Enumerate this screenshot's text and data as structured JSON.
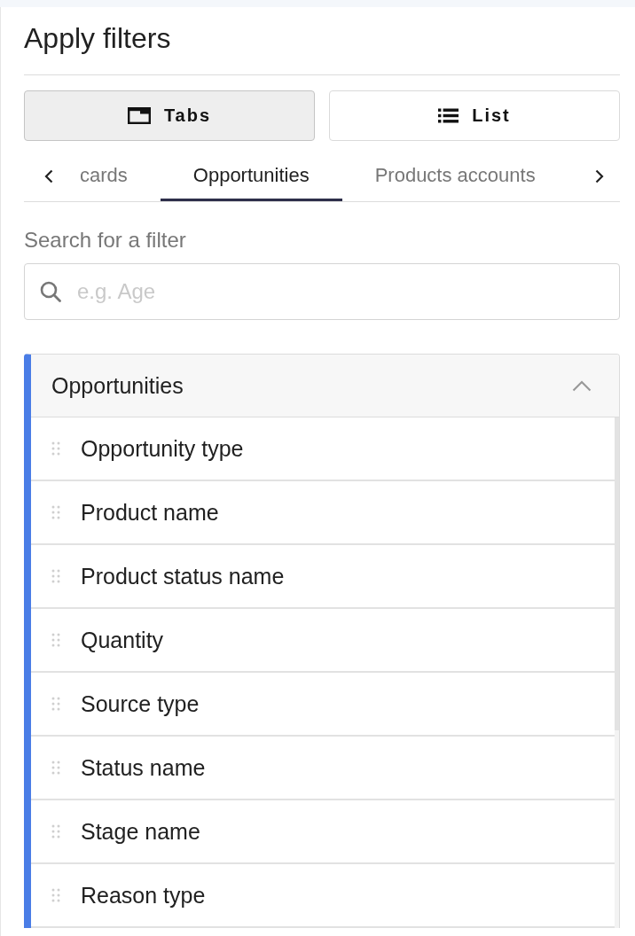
{
  "panel": {
    "title": "Apply filters"
  },
  "view_toggle": [
    {
      "kind": "tabs",
      "label": "Tabs",
      "selected": true
    },
    {
      "kind": "list",
      "label": "List",
      "selected": false
    }
  ],
  "tabs": [
    {
      "label": "cards",
      "selected": false
    },
    {
      "label": "Opportunities",
      "selected": true
    },
    {
      "label": "Products accounts",
      "selected": false
    }
  ],
  "search": {
    "label": "Search for a filter",
    "placeholder": "e.g. Age"
  },
  "section": {
    "title": "Opportunities",
    "expanded": true,
    "items": [
      "Opportunity type",
      "Product name",
      "Product status name",
      "Quantity",
      "Source type",
      "Status name",
      "Stage name",
      "Reason type"
    ]
  }
}
